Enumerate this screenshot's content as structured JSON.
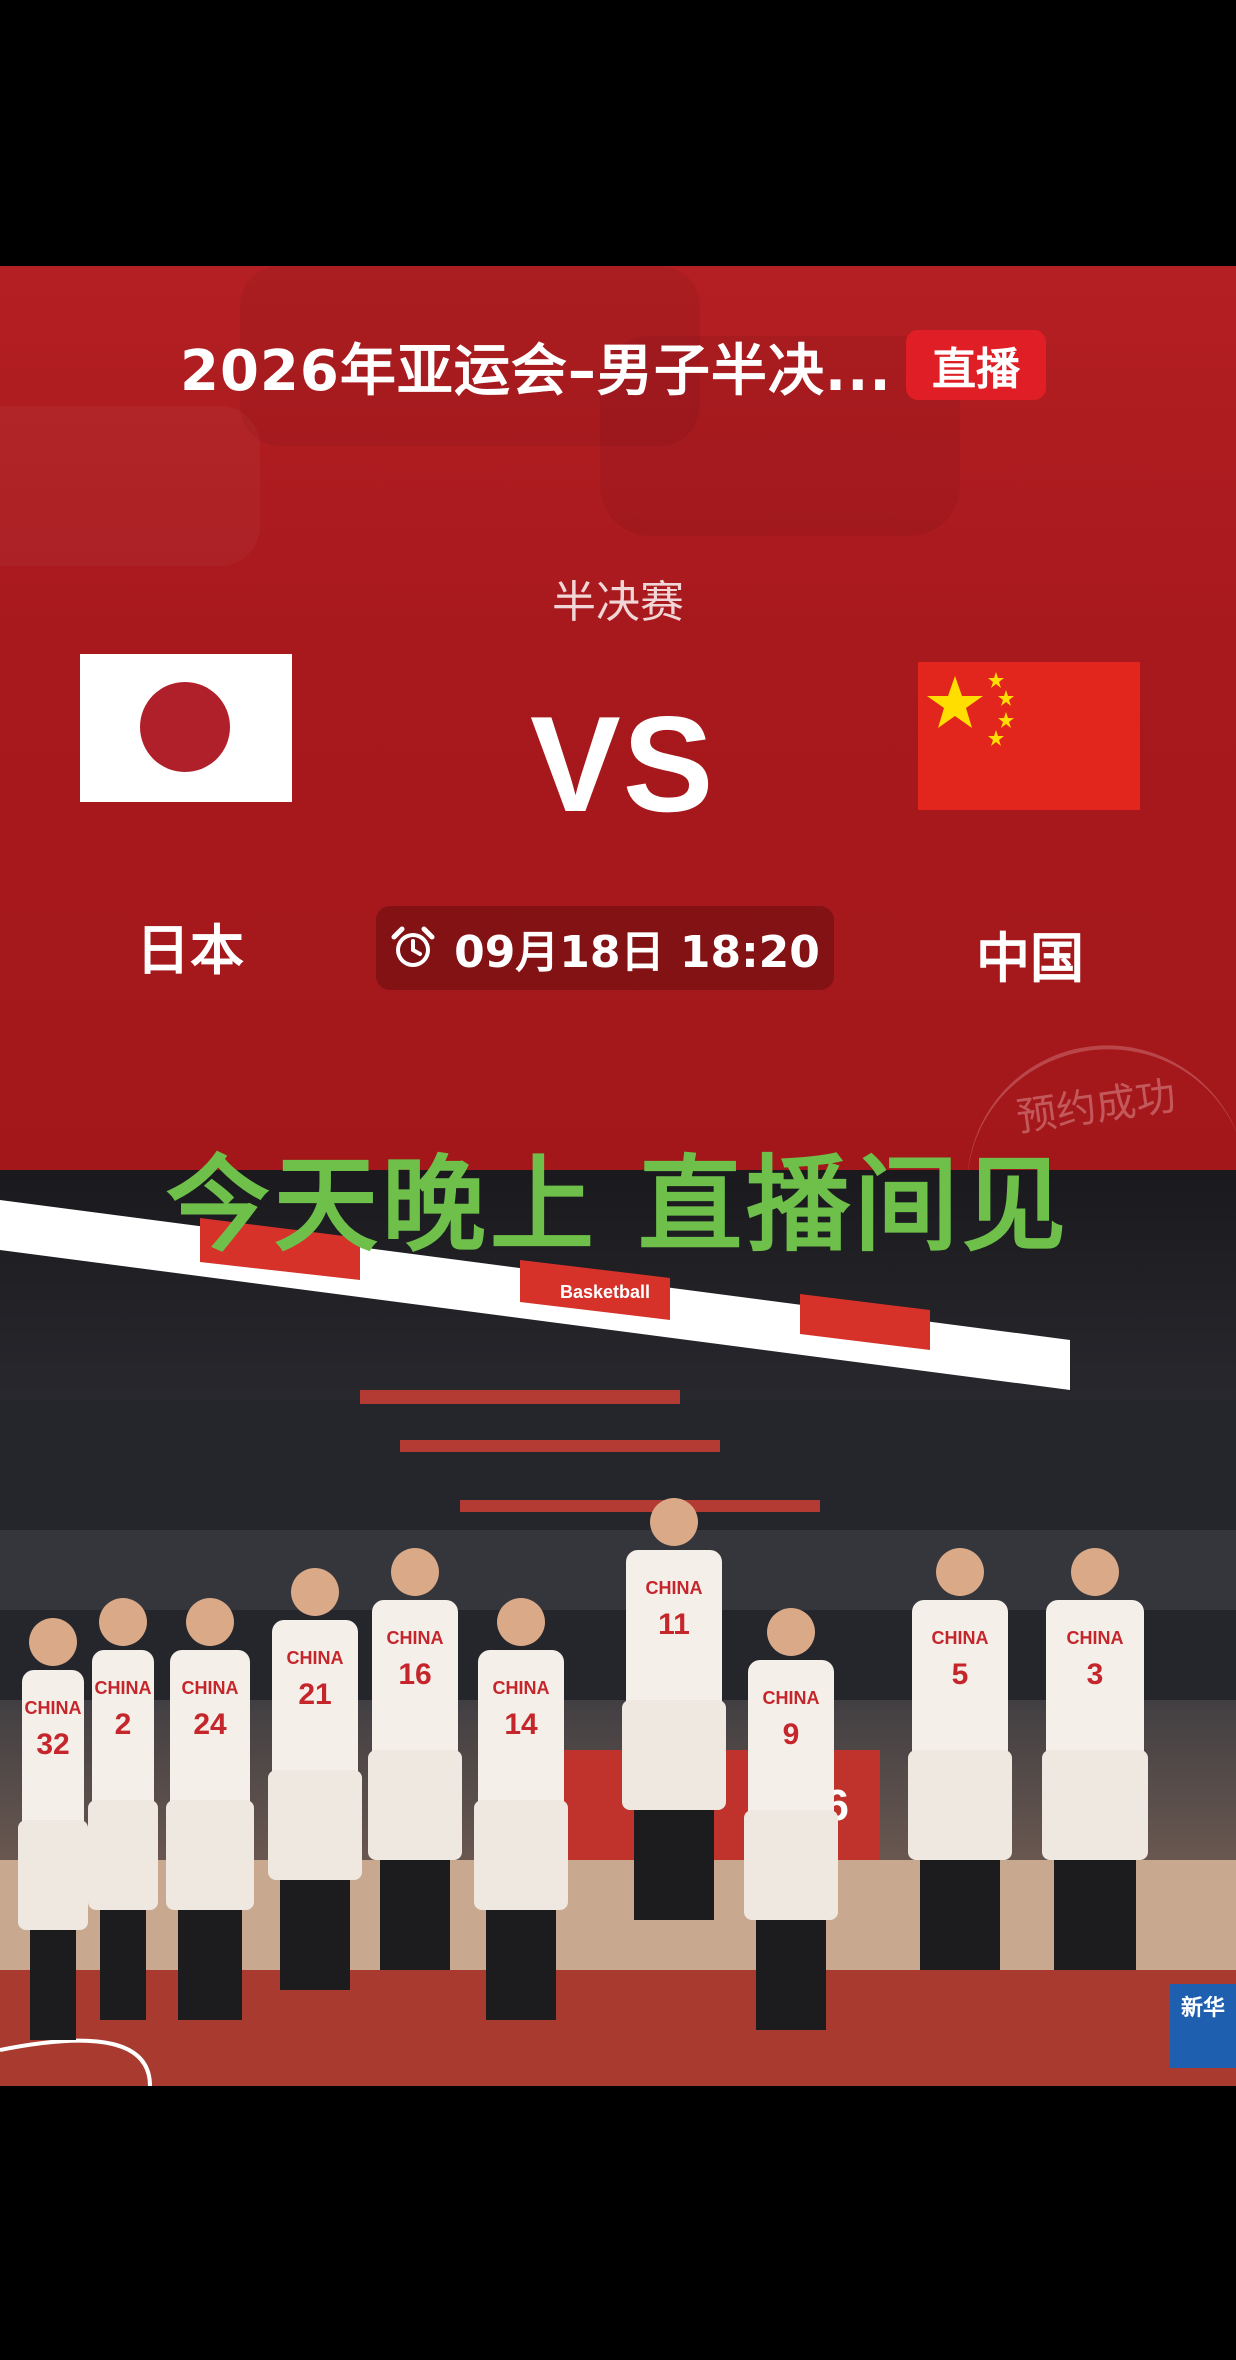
{
  "header": {
    "title": "2026年亚运会–男子半决...",
    "live_label": "直播"
  },
  "match": {
    "stage": "半决赛",
    "vs_text": "VS",
    "team_home": "日本",
    "team_away": "中国",
    "datetime": "09月18日 18:20",
    "reservation_stamp": "预约成功"
  },
  "promo": {
    "overlay_text": "今天晚上  直播间见"
  },
  "photo": {
    "description_icon": "basketball-team-lineup-photo",
    "scoreboard_text": "Basketball",
    "jersey_label": "CHINA",
    "jersey_numbers": [
      "32",
      "2",
      "24",
      "21",
      "16",
      "14",
      "11",
      "9",
      "5",
      "3"
    ],
    "banner_text": "26",
    "watermark": "新华"
  },
  "colors": {
    "card_red": "#b41f23",
    "live_red": "#e01e26",
    "overlay_green": "#6ec04a",
    "japan_red": "#b0202a",
    "china_red": "#e2261e",
    "china_yellow": "#ffde00"
  }
}
